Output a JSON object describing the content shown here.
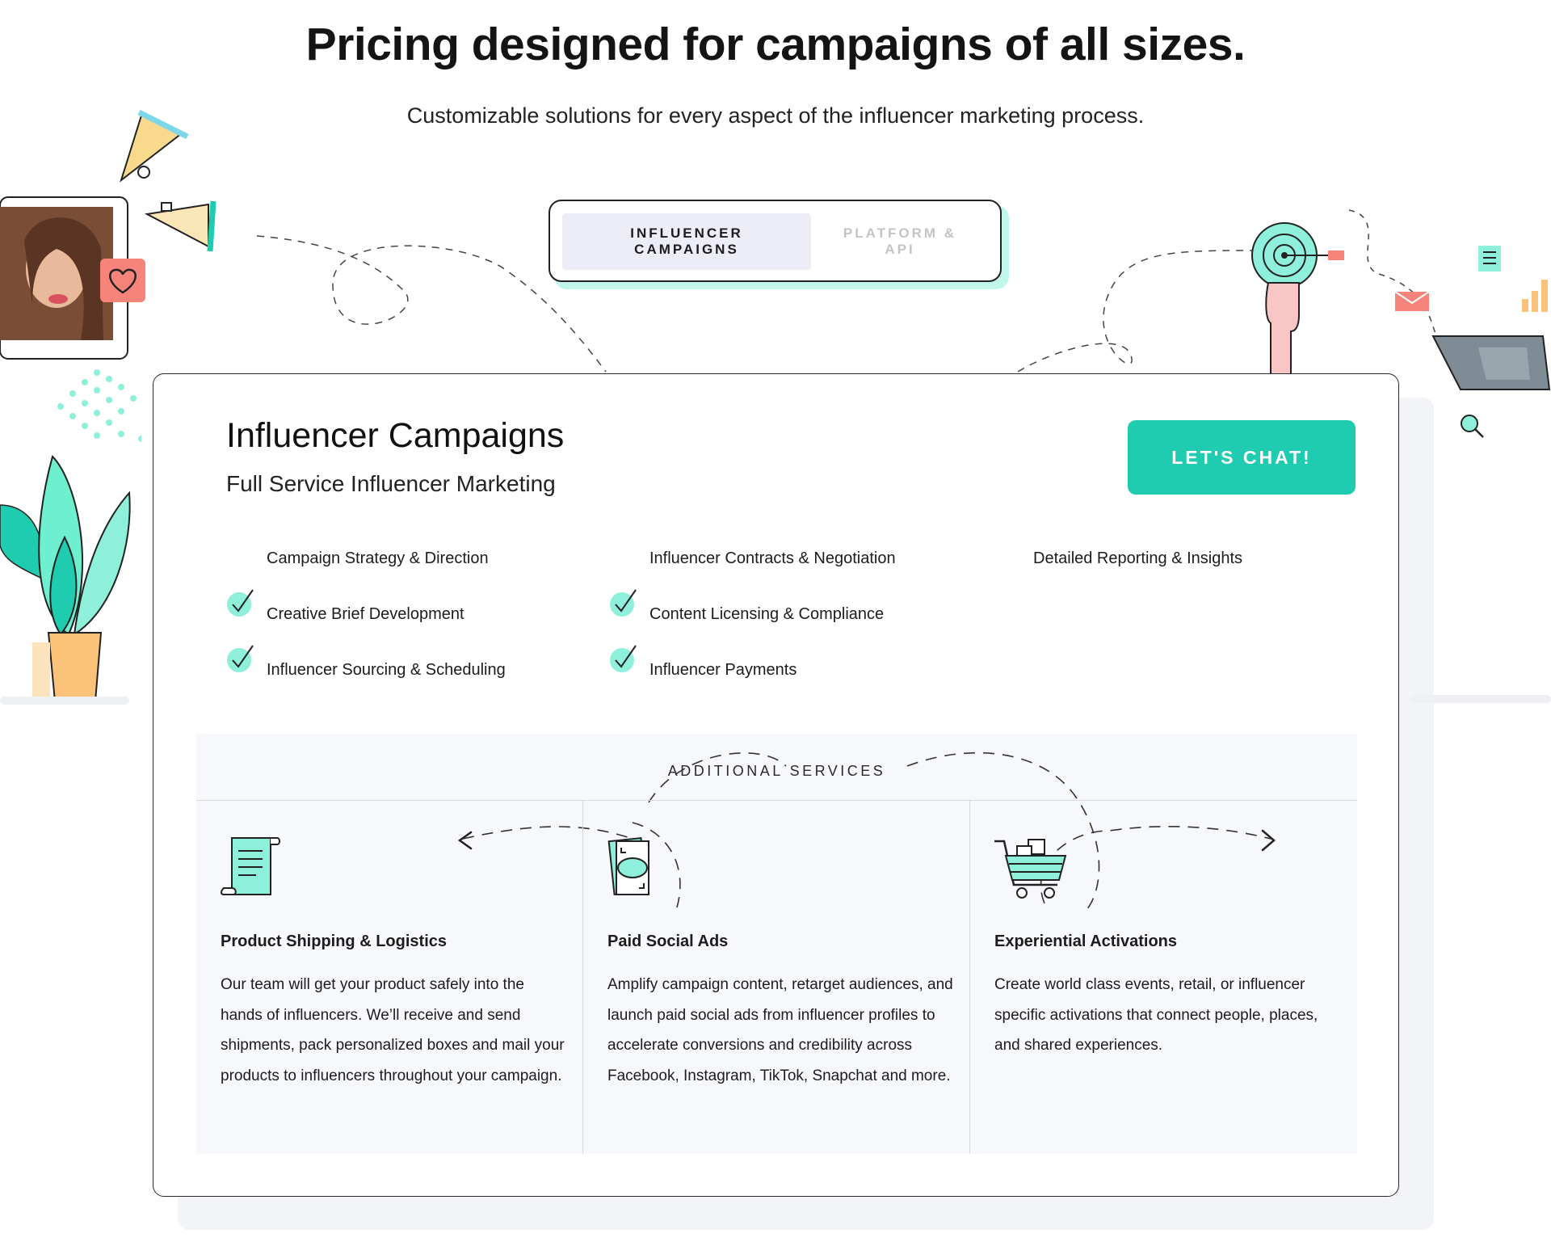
{
  "header": {
    "title": "Pricing designed for campaigns of all sizes.",
    "subtitle": "Customizable solutions for every aspect of the influencer marketing process."
  },
  "tabs": [
    {
      "label": "INFLUENCER CAMPAIGNS",
      "active": true
    },
    {
      "label": "PLATFORM & API",
      "active": false
    }
  ],
  "card": {
    "title": "Influencer Campaigns",
    "subtitle": "Full Service Influencer Marketing",
    "cta_label": "LET'S CHAT!",
    "features": [
      {
        "label": "Campaign Strategy & Direction",
        "checked": true
      },
      {
        "label": "Creative Brief Development",
        "checked": true
      },
      {
        "label": "Influencer Sourcing & Scheduling",
        "checked": true
      },
      {
        "label": "Influencer Contracts & Negotiation",
        "checked": true
      },
      {
        "label": "Content Licensing & Compliance",
        "checked": true
      },
      {
        "label": "Influencer Payments",
        "checked": true
      },
      {
        "label": "Detailed Reporting & Insights",
        "checked": true
      }
    ]
  },
  "additional_services": {
    "heading": "ADDITIONAL SERVICES",
    "items": [
      {
        "icon": "scroll-document-icon",
        "title": "Product Shipping & Logistics",
        "description": "Our team will get your product safely into the hands of influencers. We’ll receive and send shipments, pack personalized boxes and mail your products to influencers throughout your campaign."
      },
      {
        "icon": "money-bills-icon",
        "title": "Paid Social Ads",
        "description": "Amplify campaign content, retarget audiences, and launch paid social ads from influencer profiles to accelerate conversions and credibility across Facebook, Instagram, TikTok, Snapchat and more."
      },
      {
        "icon": "shopping-cart-icon",
        "title": "Experiential Activations",
        "description": "Create world class events, retail, or influencer specific activations that connect people, places, and shared experiences."
      }
    ]
  },
  "colors": {
    "accent": "#1fccb0",
    "mint": "#8ef0da",
    "panel": "#f7f8fc",
    "tab_active_bg": "#ecedf6"
  }
}
